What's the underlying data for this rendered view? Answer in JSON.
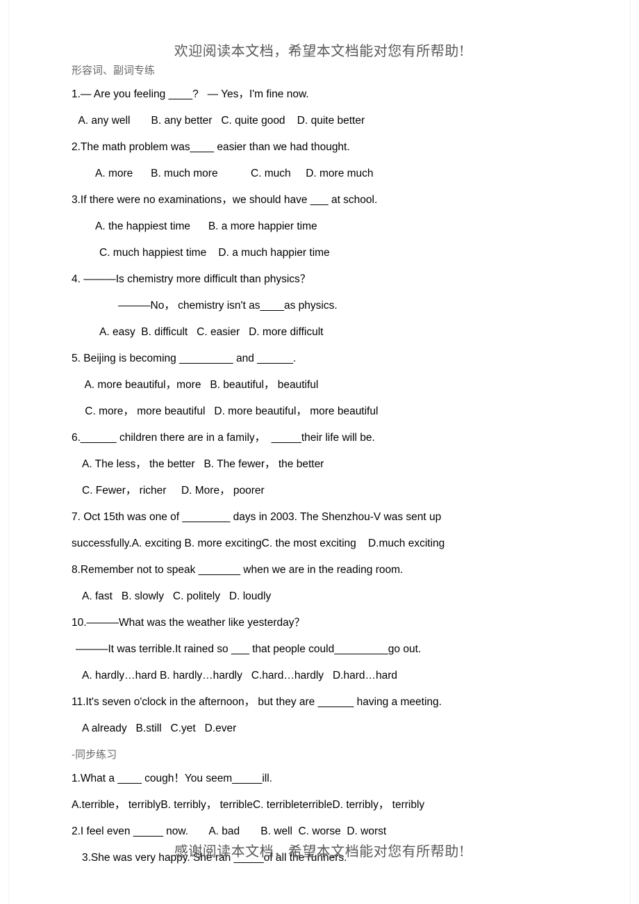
{
  "document": {
    "banner_top": "欢迎阅读本文档，希望本文档能对您有所帮助!",
    "banner_bottom": "感谢阅读本文档，希望本文档能对您有所帮助!",
    "section_heading_1": "形容词、副词专练",
    "section_heading_2": "-同步练习",
    "colors": {
      "page_background": "#ffffff",
      "body_text": "#000000",
      "banner_text": "#595959",
      "heading_text": "#666666"
    },
    "lines": [
      {
        "id": "q1-stem",
        "indent": 0,
        "text": "1.— Are you feeling ____?   — Yes，I'm fine now."
      },
      {
        "id": "q1-options",
        "indent": 1,
        "text": " A. any well       B. any better   C. quite good    D. quite better"
      },
      {
        "id": "q2-stem",
        "indent": 0,
        "text": "2.The math problem was____ easier than we had thought."
      },
      {
        "id": "q2-options",
        "indent": 5,
        "text": "A. more      B. much more           C. much     D. more much"
      },
      {
        "id": "q3-stem",
        "indent": 0,
        "text": "3.If there were no examinations，we should have ___ at school."
      },
      {
        "id": "q3-options-ab",
        "indent": 5,
        "text": "A. the happiest time      B. a more happier time"
      },
      {
        "id": "q3-options-cd",
        "indent": 6,
        "text": "C. much happiest time    D. a much happier time"
      },
      {
        "id": "q4-stem",
        "indent": 0,
        "text": "4. ———Is chemistry more difficult than physics？"
      },
      {
        "id": "q4-stem-b",
        "indent": 8,
        "text": "———No， chemistry isn't as____as physics."
      },
      {
        "id": "q4-options",
        "indent": 6,
        "text": "A. easy  B. difficult   C. easier   D. more difficult"
      },
      {
        "id": "q5-stem",
        "indent": 0,
        "text": "5. Beijing is becoming _________ and ______."
      },
      {
        "id": "q5-options-ab",
        "indent": 3,
        "text": " A. more beautiful，more   B. beautiful， beautiful"
      },
      {
        "id": "q5-options-cd",
        "indent": 3,
        "text": " C. more， more beautiful   D. more beautiful， more beautiful"
      },
      {
        "id": "q6-stem",
        "indent": 0,
        "text": "6.______ children there are in a family，  _____their life will be."
      },
      {
        "id": "q6-options-ab",
        "indent": 3,
        "text": "A. The less， the better   B. The fewer， the better"
      },
      {
        "id": "q6-options-cd",
        "indent": 3,
        "text": "C. Fewer， richer     D. More， poorer"
      },
      {
        "id": "q7-stem",
        "indent": 0,
        "text": "7. Oct 15th was one of ________ days in 2003. The Shenzhou-V was sent up"
      },
      {
        "id": "q7-options",
        "indent": 0,
        "text": "successfully.A. exciting B. more excitingC. the most exciting    D.much exciting"
      },
      {
        "id": "q8-stem",
        "indent": 0,
        "text": "8.Remember not to speak _______ when we are in the reading room."
      },
      {
        "id": "q8-options",
        "indent": 3,
        "text": "A. fast   B. slowly   C. politely   D. loudly"
      },
      {
        "id": "q10-stem",
        "indent": 0,
        "text": "10.———What was the weather like yesterday？"
      },
      {
        "id": "q10-stem-b",
        "indent": 1,
        "text": "———It was terrible.It rained so ___ that people could_________go out."
      },
      {
        "id": "q10-options",
        "indent": 3,
        "text": "A. hardly…hard B. hardly…hardly   C.hard…hardly   D.hard…hard"
      },
      {
        "id": "q11-stem",
        "indent": 0,
        "text": "11.It's seven o'clock in the afternoon， but they are ______ having a meeting."
      },
      {
        "id": "q11-options",
        "indent": 3,
        "text": "A already   B.still   C.yet   D.ever"
      }
    ],
    "lines_part2": [
      {
        "id": "p2-q1-stem",
        "indent": 0,
        "text": "1.What a ____ cough！You seem_____ill."
      },
      {
        "id": "p2-q1-options",
        "indent": 0,
        "text": "A.terrible， terriblyB. terribly， terribleC. terribleterribleD. terribly， terribly"
      },
      {
        "id": "p2-q2",
        "indent": 0,
        "text": "2.I feel even _____ now.       A. bad       B. well  C. worse  D. worst"
      },
      {
        "id": "p2-q3",
        "indent": 3,
        "text": "3.She was very happy. She ran _____of all the runners."
      }
    ]
  }
}
